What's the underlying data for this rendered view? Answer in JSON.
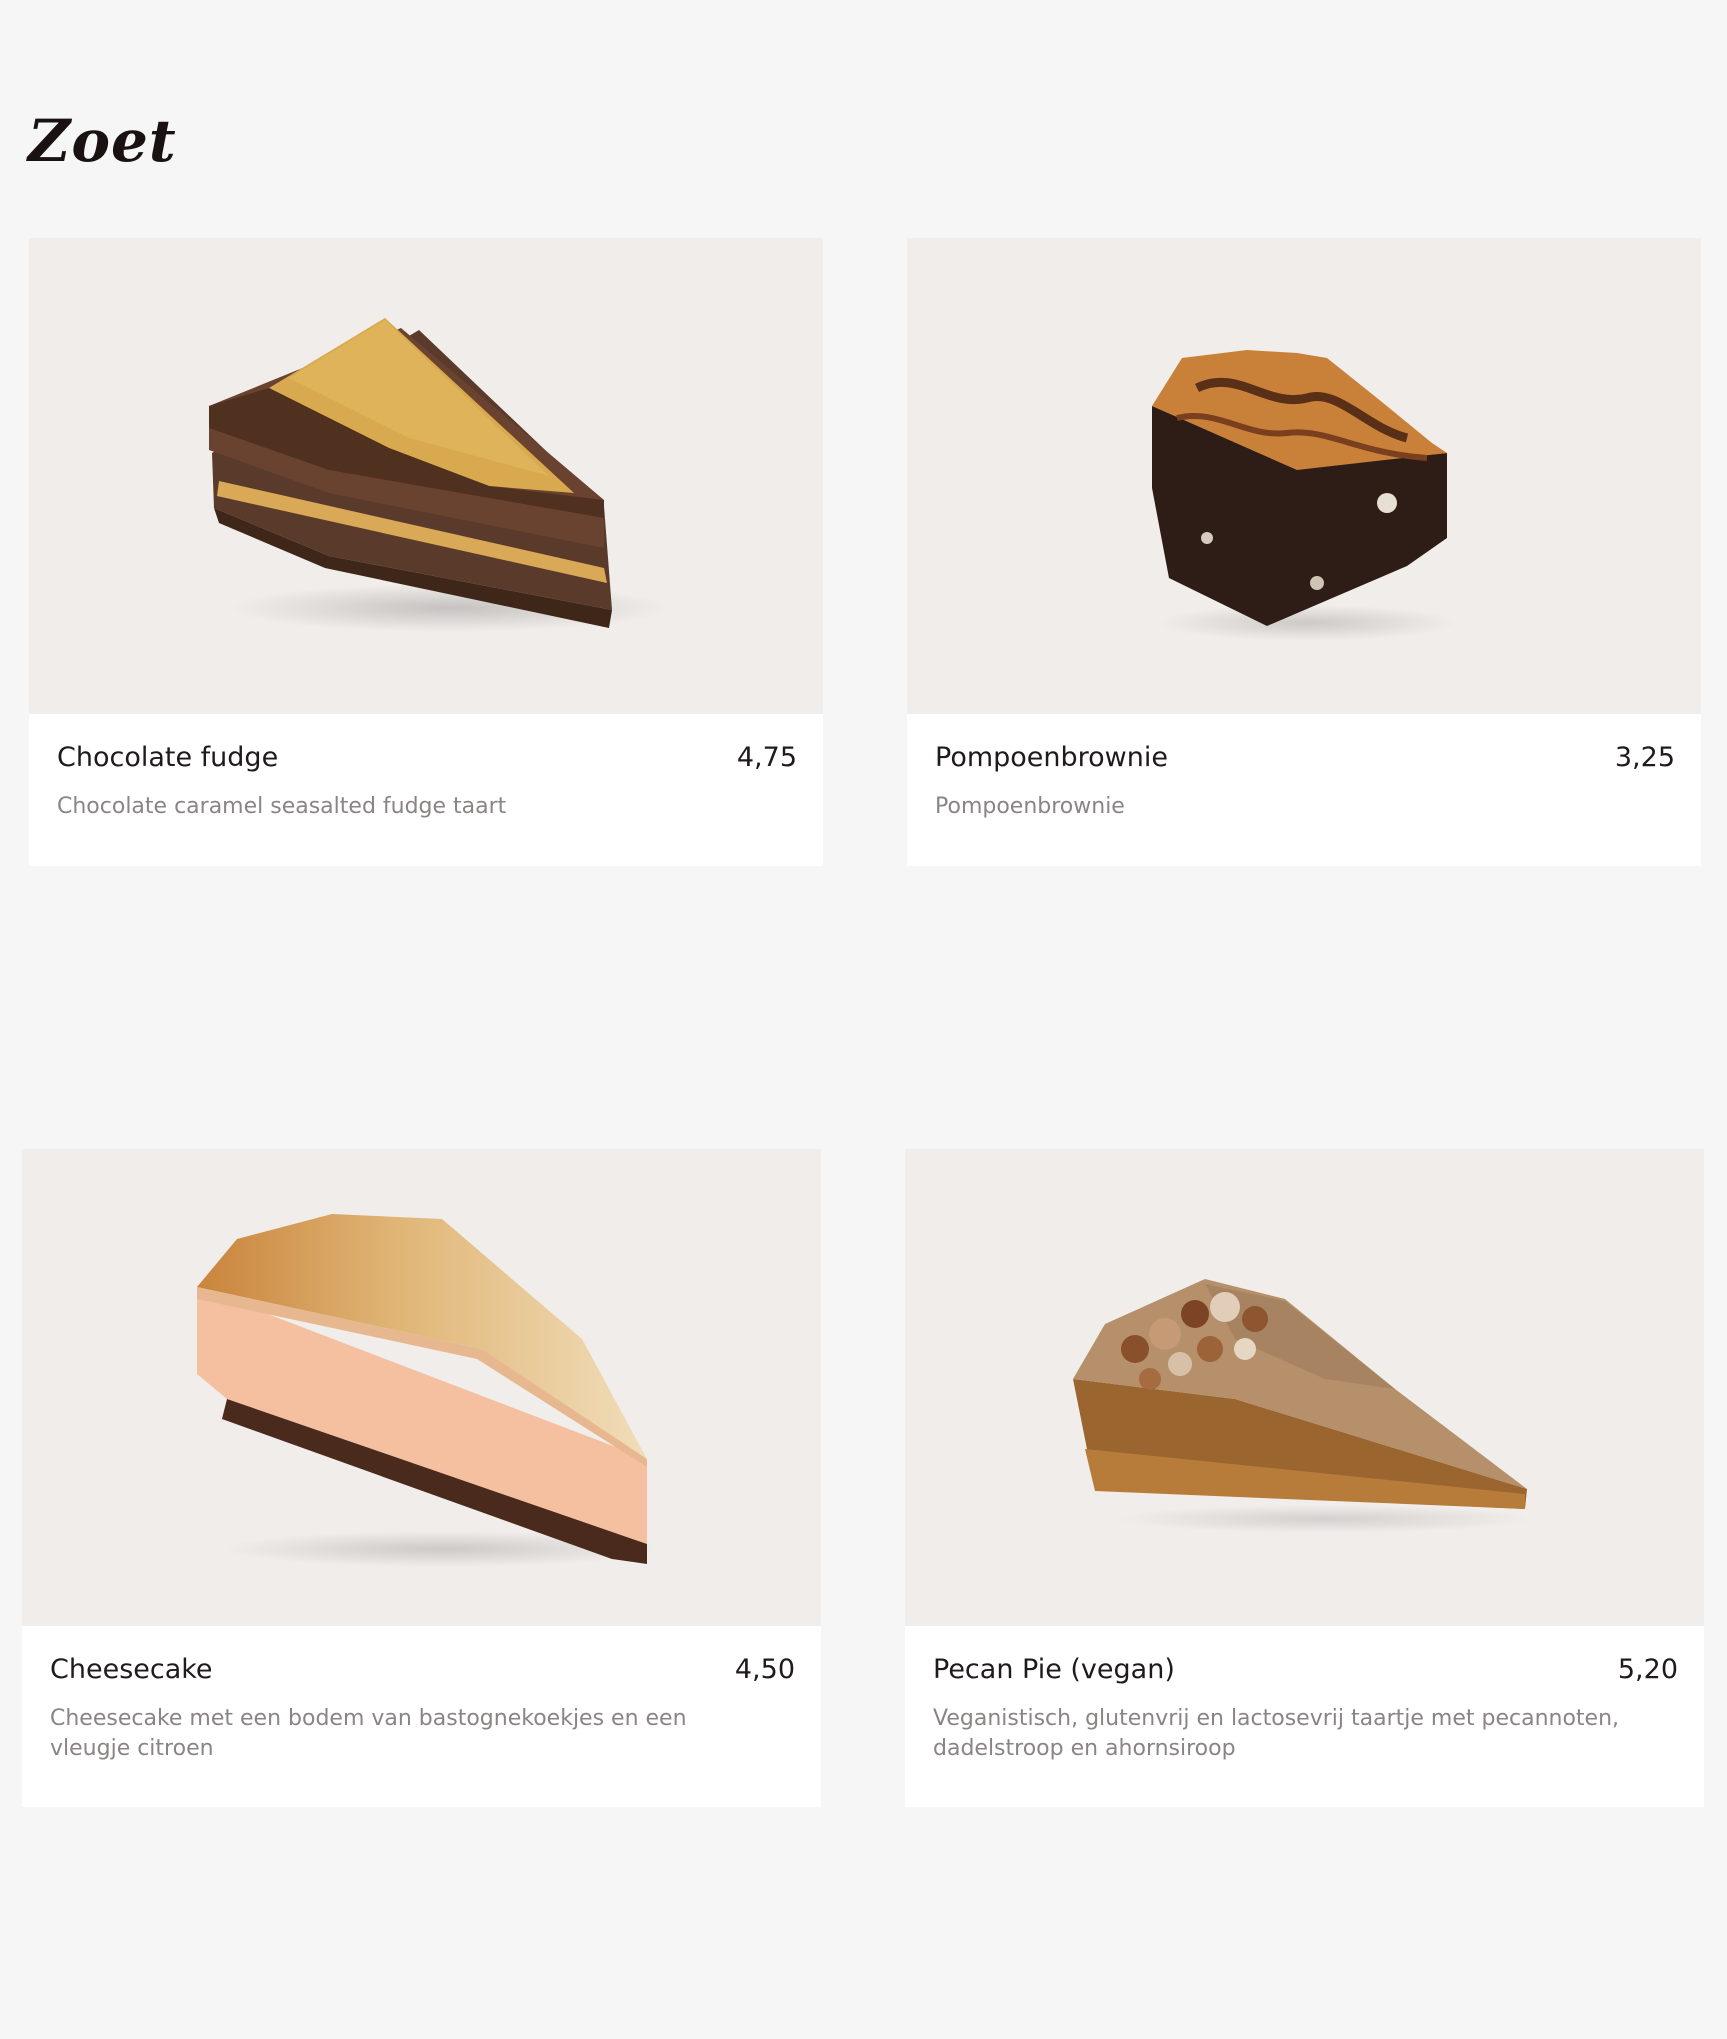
{
  "section": {
    "title": "Zoet"
  },
  "products": [
    {
      "name": "Chocolate fudge",
      "price": "4,75",
      "description": "Chocolate caramel seasalted fudge taart",
      "image_icon": "chocolate-fudge-slice"
    },
    {
      "name": "Pompoenbrownie",
      "price": "3,25",
      "description": "Pompoenbrownie",
      "image_icon": "pumpkin-brownie"
    },
    {
      "name": "Cheesecake",
      "price": "4,50",
      "description": "Cheesecake met een bodem van bastognekoekjes en een vleugje citroen",
      "image_icon": "cheesecake-slice"
    },
    {
      "name": "Pecan Pie (vegan)",
      "price": "5,20",
      "description": "Veganistisch, glutenvrij en lactosevrij taartje met pecannoten, dadelstroop en ahornsiroop",
      "image_icon": "pecan-pie-slice"
    }
  ],
  "colors": {
    "page_background": "#f6f6f6",
    "image_background": "#f0edea",
    "card_background": "#ffffff",
    "title_text": "#1a1112",
    "name_text": "#1f1a1b",
    "description_text": "#8a8584"
  }
}
